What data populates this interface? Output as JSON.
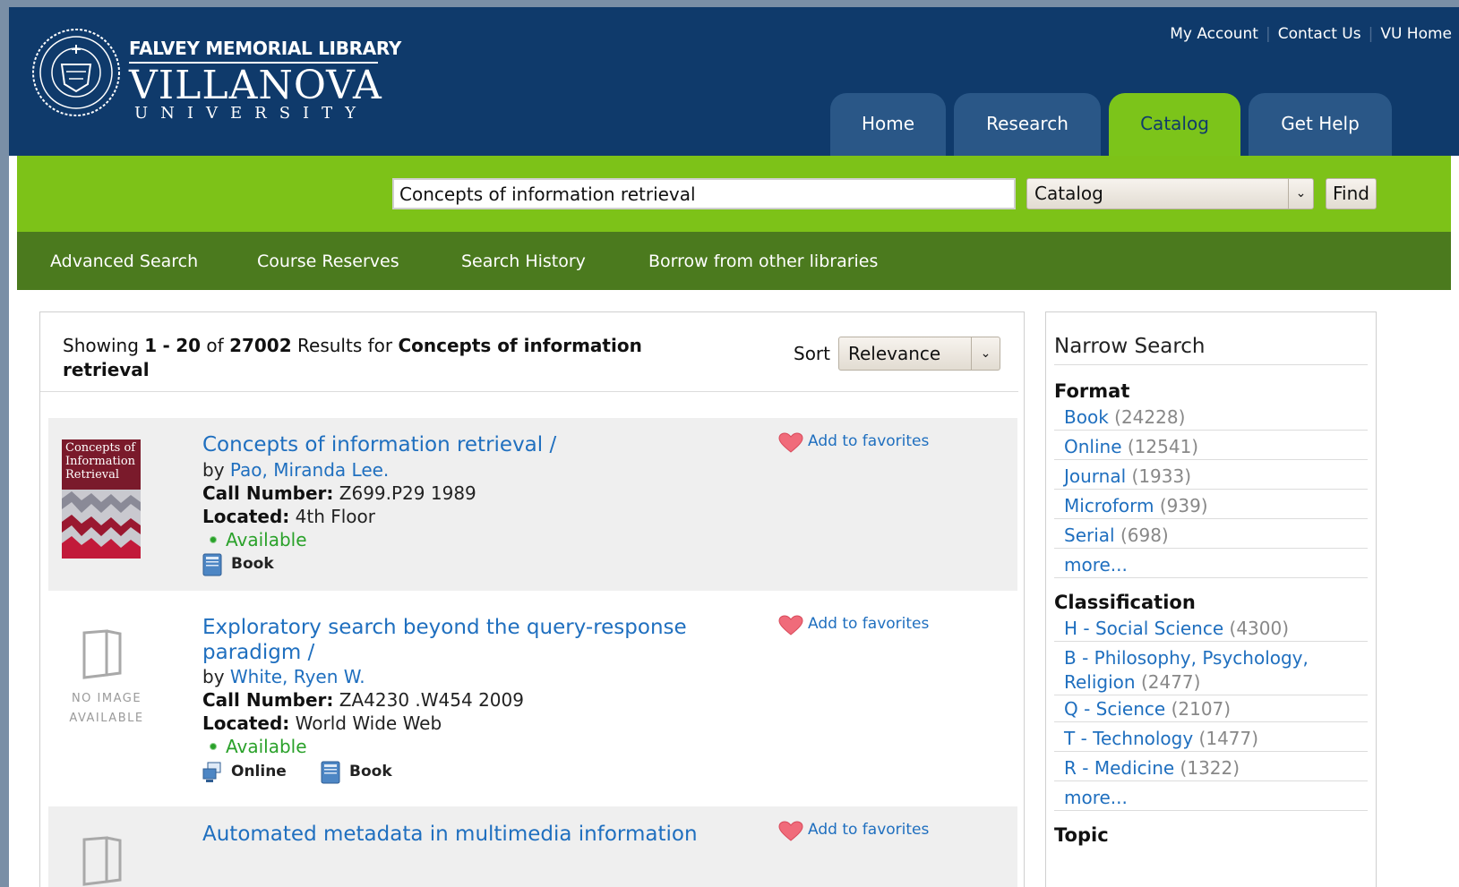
{
  "header": {
    "logo_top": "FALVEY MEMORIAL LIBRARY",
    "logo_main": "VILLANOVA",
    "logo_sub": "UNIVERSITY",
    "util_links": [
      "My Account",
      "Contact Us",
      "VU Home"
    ],
    "tabs": [
      "Home",
      "Research",
      "Catalog",
      "Get Help"
    ],
    "active_tab": "Catalog",
    "active_tab_color": "#7cc41a",
    "header_color": "#0f3a6b"
  },
  "search": {
    "query": "Concepts of information retrieval",
    "scope": "Catalog",
    "find_label": "Find"
  },
  "subnav": [
    "Advanced Search",
    "Course Reserves",
    "Search History",
    "Borrow from other libraries"
  ],
  "results": {
    "showing_prefix": "Showing",
    "range_start": "1",
    "range_sep": "-",
    "range_end": "20",
    "of_label": "of",
    "total": "27002",
    "results_for": "Results for",
    "query": "Concepts of information retrieval",
    "sort_label": "Sort",
    "sort_value": "Relevance",
    "labels": {
      "by": "by",
      "call_number": "Call Number:",
      "located": "Located:",
      "add_to_favorites": "Add to favorites",
      "no_image_1": "NO IMAGE",
      "no_image_2": "AVAILABLE"
    },
    "records": [
      {
        "title": "Concepts of information retrieval /",
        "author": "Pao, Miranda Lee.",
        "call_number": "Z699.P29 1989",
        "located": "4th Floor",
        "status": "Available",
        "formats": [
          "Book"
        ],
        "cover_text": "Concepts of Information Retrieval"
      },
      {
        "title": "Exploratory search beyond the query-response paradigm /",
        "author": "White, Ryen W.",
        "call_number": "ZA4230 .W454 2009",
        "located": "World Wide Web",
        "status": "Available",
        "formats": [
          "Online",
          "Book"
        ]
      },
      {
        "title": "Automated metadata in multimedia information"
      }
    ]
  },
  "sidebar": {
    "title": "Narrow Search",
    "format": {
      "heading": "Format",
      "items": [
        {
          "label": "Book",
          "count": "(24228)"
        },
        {
          "label": "Online",
          "count": "(12541)"
        },
        {
          "label": "Journal",
          "count": "(1933)"
        },
        {
          "label": "Microform",
          "count": "(939)"
        },
        {
          "label": "Serial",
          "count": "(698)"
        }
      ],
      "more": "more..."
    },
    "classification": {
      "heading": "Classification",
      "items": [
        {
          "label": "H - Social Science",
          "count": "(4300)"
        },
        {
          "label": "B - Philosophy, Psychology, Religion",
          "count": "(2477)"
        },
        {
          "label": "Q - Science",
          "count": "(2107)"
        },
        {
          "label": "T - Technology",
          "count": "(1477)"
        },
        {
          "label": "R - Medicine",
          "count": "(1322)"
        }
      ],
      "more": "more..."
    },
    "topic": {
      "heading": "Topic"
    }
  }
}
